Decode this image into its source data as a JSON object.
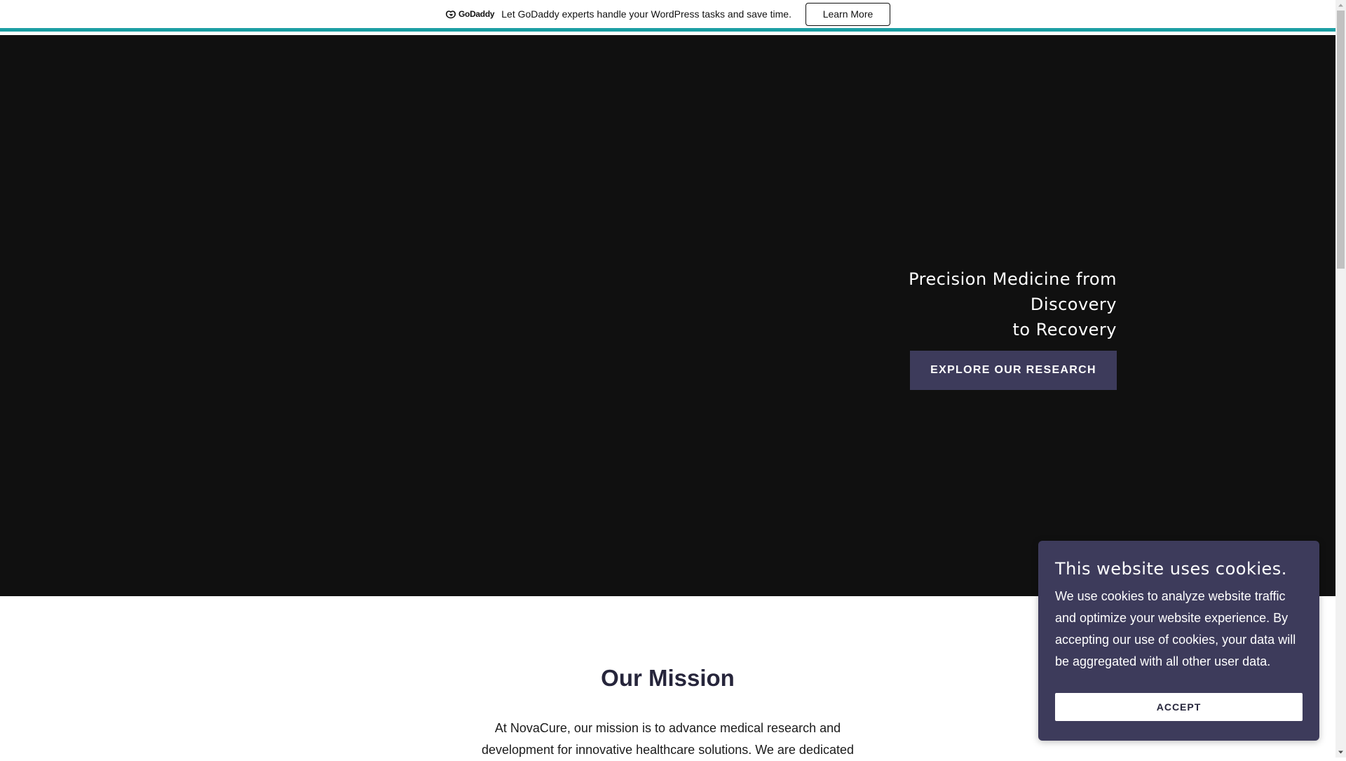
{
  "promo_bar": {
    "logo_text": "GoDaddy",
    "message": "Let GoDaddy experts handle your WordPress tasks and save time.",
    "button_label": "Learn More",
    "accent_color": "#1a9ea3"
  },
  "hero": {
    "title_line1": "Precision Medicine from Discovery",
    "title_line2": "to Recovery",
    "button_label": "EXPLORE OUR RESEARCH",
    "background_color": "#101010",
    "button_color": "#3d3b5b"
  },
  "mission": {
    "title": "Our Mission",
    "text": "At NovaCure, our mission is to advance medical research and development for innovative healthcare solutions. We are dedicated"
  },
  "cookie_dialog": {
    "title": "This website uses cookies.",
    "text": "We use cookies to analyze website traffic and optimize your website experience. By accepting our use of cookies, your data will be aggregated with all other user data.",
    "accept_label": "ACCEPT",
    "background_color": "#3d3b5b"
  },
  "icons": {
    "logo": "godaddy-logo-icon",
    "scroll_up": "scroll-up-arrow-icon",
    "scroll_down": "scroll-down-arrow-icon"
  }
}
